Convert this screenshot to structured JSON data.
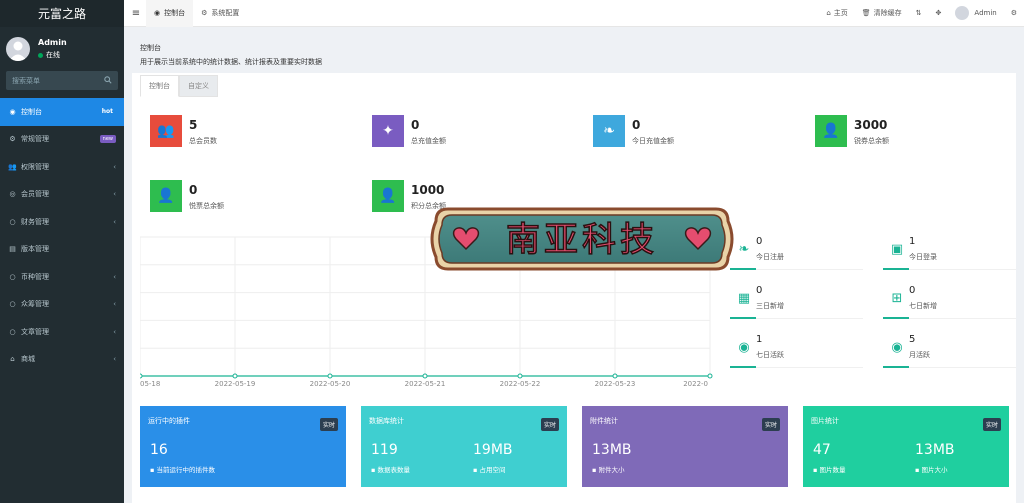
{
  "sidebar": {
    "brand": "元富之路",
    "user_name": "Admin",
    "user_status": "在线",
    "search_placeholder": "搜索菜单",
    "items": [
      {
        "label": "控制台",
        "badge": "hot",
        "icon": "dashboard-icon"
      },
      {
        "label": "常规管理",
        "badge": "new",
        "icon": "cogs-icon"
      },
      {
        "label": "权限管理",
        "icon": "group-icon"
      },
      {
        "label": "会员管理",
        "icon": "user-circle-icon"
      },
      {
        "label": "财务管理",
        "icon": "circle-icon"
      },
      {
        "label": "版本管理",
        "icon": "file-icon"
      },
      {
        "label": "币种管理",
        "icon": "circle-icon"
      },
      {
        "label": "众筹管理",
        "icon": "circle-icon"
      },
      {
        "label": "文章管理",
        "icon": "circle-icon"
      },
      {
        "label": "商城",
        "icon": "home-icon"
      }
    ]
  },
  "topbar": {
    "tabs": [
      {
        "label": "控制台",
        "icon": "dashboard-icon"
      },
      {
        "label": "系统配置",
        "icon": "gear-icon"
      }
    ],
    "home": "主页",
    "clear_cache": "清除缓存",
    "admin": "Admin"
  },
  "content": {
    "title": "控制台",
    "description": "用于展示当前系统中的统计数据、统计报表及重要实时数据",
    "subtabs": [
      "控制台",
      "自定义"
    ]
  },
  "stats": [
    {
      "value": "5",
      "label": "总会员数",
      "color": "#e74c3c",
      "icon": "users-icon"
    },
    {
      "value": "0",
      "label": "总充值金额",
      "color": "#7a5cc1",
      "icon": "magic-icon"
    },
    {
      "value": "0",
      "label": "今日充值金额",
      "color": "#3ea8dd",
      "icon": "leaf-icon"
    },
    {
      "value": "3000",
      "label": "锐券总余额",
      "color": "#2ebd4f",
      "icon": "user-icon"
    },
    {
      "value": "0",
      "label": "悦票总余额",
      "color": "#2ebd4f",
      "icon": "user-icon"
    },
    {
      "value": "1000",
      "label": "积分总余额",
      "color": "#2ebd4f",
      "icon": "user-icon"
    }
  ],
  "mini_stats": [
    {
      "value": "0",
      "label": "今日注册",
      "icon": "leaf-icon"
    },
    {
      "value": "1",
      "label": "今日登录",
      "icon": "id-card-icon"
    },
    {
      "value": "0",
      "label": "三日新增",
      "icon": "calendar-icon"
    },
    {
      "value": "0",
      "label": "七日新增",
      "icon": "calendar-plus-icon"
    },
    {
      "value": "1",
      "label": "七日活跃",
      "icon": "user-circle-icon"
    },
    {
      "value": "5",
      "label": "月活跃",
      "icon": "user-circle-icon"
    }
  ],
  "chart_data": {
    "type": "line",
    "x": [
      "05-18",
      "2022-05-19",
      "2022-05-20",
      "2022-05-21",
      "2022-05-22",
      "2022-05-23",
      "2022-05-24"
    ],
    "x_tick_labels": [
      "05-18",
      "2022-05-19",
      "2022-05-20",
      "2022-05-21",
      "2022-05-22",
      "2022-05-23",
      "2022-0"
    ],
    "series": [
      {
        "values": [
          0,
          0,
          0,
          0,
          0,
          0,
          0
        ],
        "color": "#1ab394"
      }
    ],
    "grid": true
  },
  "bottom_cards": [
    {
      "title": "运行中的插件",
      "tag": "实时",
      "color": "#2a8fe8",
      "values": [
        {
          "value": "16",
          "sub": "当前运行中的插件数"
        }
      ]
    },
    {
      "title": "数据库统计",
      "tag": "实时",
      "color": "#3fcfd0",
      "values": [
        {
          "value": "119",
          "sub": "数据表数量"
        },
        {
          "value": "19MB",
          "sub": "占用空间"
        }
      ]
    },
    {
      "title": "附件统计",
      "tag": "实时",
      "color": "#7f6ab8",
      "values": [
        {
          "value": "13MB",
          "sub": "附件大小"
        }
      ]
    },
    {
      "title": "图片统计",
      "tag": "实时",
      "color": "#1fcf9f",
      "values": [
        {
          "value": "47",
          "sub": "图片数量"
        },
        {
          "value": "13MB",
          "sub": "图片大小"
        }
      ]
    }
  ],
  "watermark": "南亚科技"
}
